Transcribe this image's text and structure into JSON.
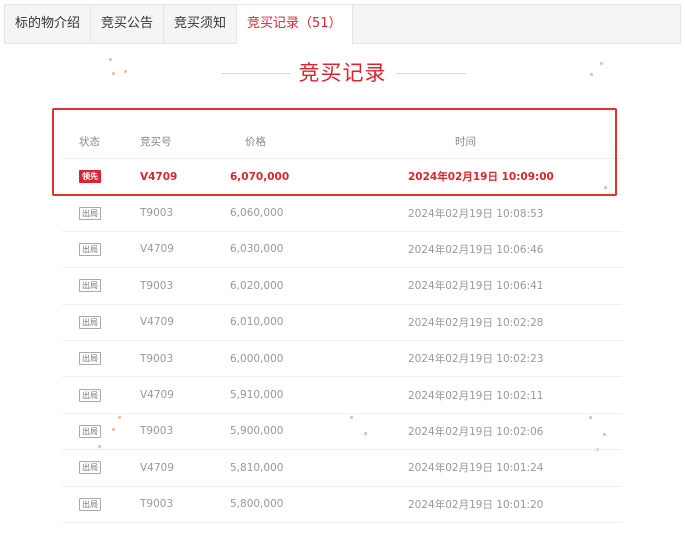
{
  "tabs": [
    {
      "label": "标的物介绍"
    },
    {
      "label": "竞买公告"
    },
    {
      "label": "竞买须知"
    },
    {
      "label": "竞买记录（51）"
    }
  ],
  "section_title": "竞买记录",
  "table": {
    "headers": {
      "status": "状态",
      "code": "竞买号",
      "price": "价格",
      "time": "时间"
    },
    "rows": [
      {
        "status": "领先",
        "code": "V4709",
        "price": "6,070,000",
        "time": "2024年02月19日 10:09:00"
      },
      {
        "status": "出局",
        "code": "T9003",
        "price": "6,060,000",
        "time": "2024年02月19日 10:08:53"
      },
      {
        "status": "出局",
        "code": "V4709",
        "price": "6,030,000",
        "time": "2024年02月19日 10:06:46"
      },
      {
        "status": "出局",
        "code": "T9003",
        "price": "6,020,000",
        "time": "2024年02月19日 10:06:41"
      },
      {
        "status": "出局",
        "code": "V4709",
        "price": "6,010,000",
        "time": "2024年02月19日 10:02:28"
      },
      {
        "status": "出局",
        "code": "T9003",
        "price": "6,000,000",
        "time": "2024年02月19日 10:02:23"
      },
      {
        "status": "出局",
        "code": "V4709",
        "price": "5,910,000",
        "time": "2024年02月19日 10:02:11"
      },
      {
        "status": "出局",
        "code": "T9003",
        "price": "5,900,000",
        "time": "2024年02月19日 10:02:06"
      },
      {
        "status": "出局",
        "code": "V4709",
        "price": "5,810,000",
        "time": "2024年02月19日 10:01:24"
      },
      {
        "status": "出局",
        "code": "T9003",
        "price": "5,800,000",
        "time": "2024年02月19日 10:01:20"
      }
    ]
  },
  "colors": {
    "accent": "#d9262e",
    "highlight_border": "#e3342a"
  }
}
